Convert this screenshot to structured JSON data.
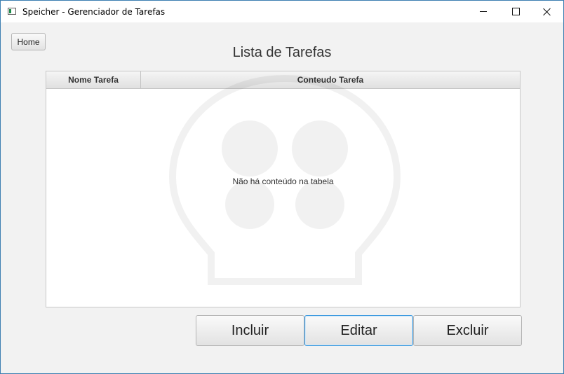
{
  "window": {
    "title": "Speicher - Gerenciador de Tarefas"
  },
  "toolbar": {
    "home_label": "Home"
  },
  "page": {
    "title": "Lista de Tarefas"
  },
  "table": {
    "columns": [
      "Nome Tarefa",
      "Conteudo Tarefa"
    ],
    "rows": [],
    "empty_message": "Não há conteúdo na tabela"
  },
  "actions": {
    "incluir": "Incluir",
    "editar": "Editar",
    "excluir": "Excluir"
  },
  "icons": {
    "app": "app-window-icon",
    "minimize": "minimize-icon",
    "maximize": "maximize-icon",
    "close": "close-icon",
    "watermark": "lightbulb-brain-icon"
  },
  "colors": {
    "focus_border": "#3c9ae0",
    "window_border": "#3c7fb1"
  }
}
